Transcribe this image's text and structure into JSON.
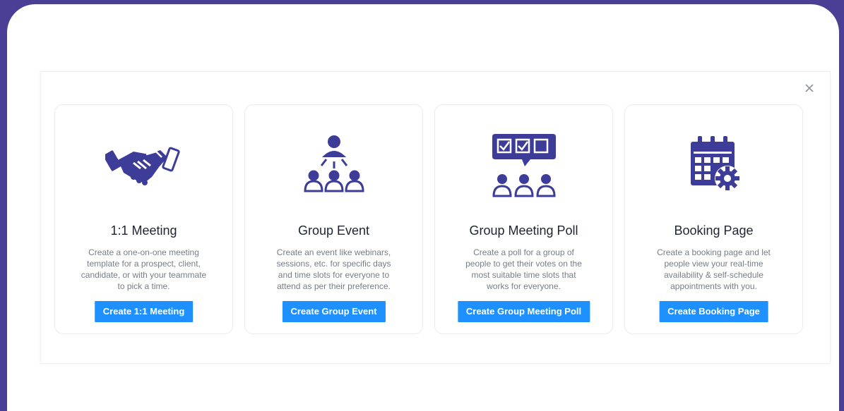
{
  "colors": {
    "background": "#4a3f94",
    "icon": "#3d3d99",
    "button": "#1e90ff"
  },
  "modal": {
    "close_icon": "close-icon",
    "cards": [
      {
        "icon": "handshake-icon",
        "title": "1:1 Meeting",
        "description": "Create a one-on-one meeting template for a prospect, client, candidate, or with your teammate to pick a time.",
        "button": "Create 1:1 Meeting"
      },
      {
        "icon": "group-hierarchy-icon",
        "title": "Group Event",
        "description": "Create an event like webinars, sessions, etc. for specific days and time slots for everyone to attend as per their preference.",
        "button": "Create Group Event"
      },
      {
        "icon": "poll-group-icon",
        "title": "Group Meeting Poll",
        "description": "Create a poll for a group of people to get their votes on the most suitable time slots that works for everyone.",
        "button": "Create Group Meeting Poll"
      },
      {
        "icon": "calendar-gear-icon",
        "title": "Booking Page",
        "description": "Create a booking page and let people view your real-time availability & self-schedule appointments with you.",
        "button": "Create Booking Page"
      }
    ]
  }
}
